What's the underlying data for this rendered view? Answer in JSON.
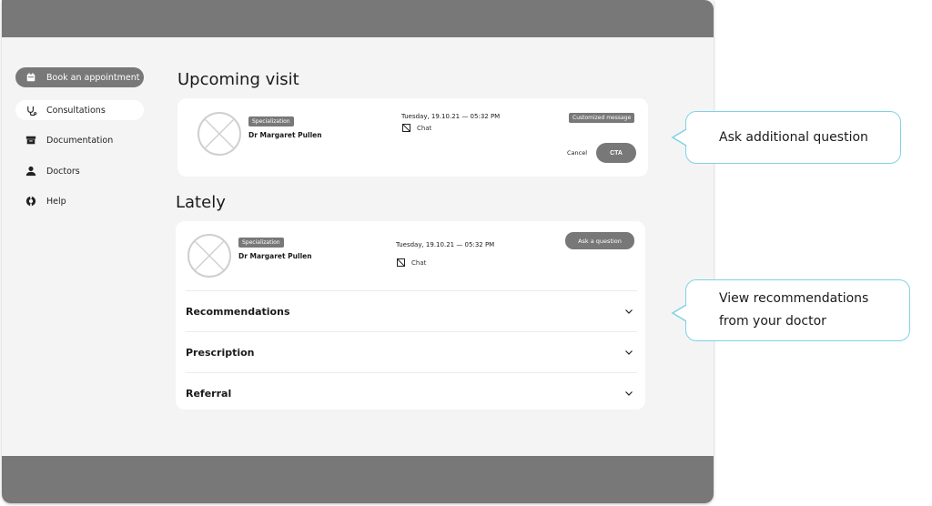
{
  "sidebar": {
    "items": [
      {
        "label": "Book an appointment",
        "icon": "calendar-icon"
      },
      {
        "label": "Consultations",
        "icon": "stethoscope-icon"
      },
      {
        "label": "Documentation",
        "icon": "archive-box-icon"
      },
      {
        "label": "Doctors",
        "icon": "person-icon"
      },
      {
        "label": "Help",
        "icon": "help-lifebuoy-icon"
      }
    ]
  },
  "upcoming": {
    "title": "Upcoming visit",
    "specialization": "Specialization",
    "doctor": "Dr Margaret Pullen",
    "datetime": "Tuesday, 19.10.21 — 05:32 PM",
    "mode": "Chat",
    "custom_tag": "Customized message",
    "cancel_label": "Cancel",
    "cta_label": "CTA"
  },
  "lately": {
    "title": "Lately",
    "specialization": "Specialization",
    "doctor": "Dr Margaret Pullen",
    "datetime": "Tuesday, 19.10.21 — 05:32 PM",
    "mode": "Chat",
    "ask_label": "Ask a question",
    "sections": [
      {
        "label": "Recommendations"
      },
      {
        "label": "Prescription"
      },
      {
        "label": "Referral"
      }
    ]
  },
  "callouts": {
    "ask": "Ask additional question",
    "recommendations_line1": "View recommendations",
    "recommendations_line2": "from your doctor"
  },
  "colors": {
    "bar_gray": "#787878",
    "background": "#f4f4f4",
    "callout_border": "#7fd2e4"
  }
}
